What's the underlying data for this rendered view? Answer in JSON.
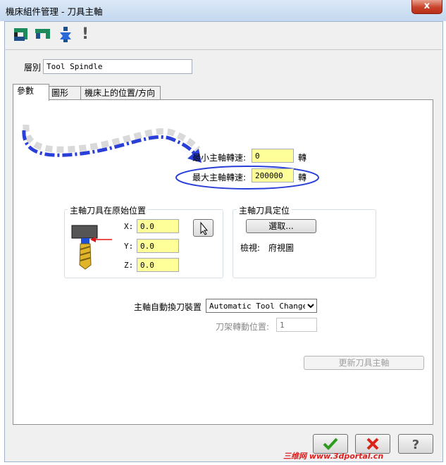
{
  "window": {
    "title": "機床組件管理 - 刀具主軸",
    "close_glyph": "x"
  },
  "toolbar": {
    "icons": [
      "component-type-icon",
      "spindle-type-icon",
      "tool-icon",
      "warning-icon"
    ],
    "warning_glyph": "!"
  },
  "layer": {
    "label": "層別",
    "value": "Tool Spindle"
  },
  "tabs": [
    "參數",
    "圖形",
    "機床上的位置/方向"
  ],
  "speed": {
    "min_label": "最小主軸轉速:",
    "min_value": "0",
    "min_unit": "轉",
    "max_label": "最大主軸轉速:",
    "max_value": "200000",
    "max_unit": "轉"
  },
  "home_position": {
    "title": "主軸刀具在原始位置",
    "x_label": "X:",
    "x_value": "0.0",
    "y_label": "Y:",
    "y_value": "0.0",
    "z_label": "Z:",
    "z_value": "0.0"
  },
  "orientation": {
    "title": "主軸刀具定位",
    "select_label": "選取...",
    "view_label": "檢視:",
    "view_value": "府視圖"
  },
  "atc": {
    "label": "主軸自動換刀裝置",
    "selected": "Automatic Tool Changer",
    "pos_label": "刀架轉動位置:",
    "pos_value": "1"
  },
  "update_button": "更新刀具主軸",
  "watermark": "三维网 www.3dportal.cn",
  "colors": {
    "field_yellow": "#ffff99",
    "annotation_blue": "#2a3fd8",
    "ok_green": "#2d9c1e",
    "cancel_red": "#d9241a"
  }
}
